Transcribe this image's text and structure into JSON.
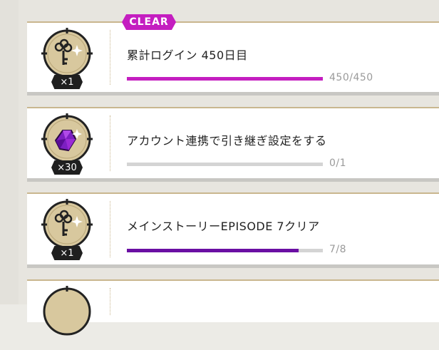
{
  "colors": {
    "clear_badge": "#c41ec0",
    "bar_magenta": "#c41ec0",
    "bar_purple": "#6a0fa3",
    "bar_track": "#d4d4d4",
    "gold_frame": "#c9b68e"
  },
  "missions": [
    {
      "status_badge": "CLEAR",
      "reward_icon": "key-icon",
      "reward_count": "×1",
      "title": "累計ログイン 450日目",
      "progress_text": "450/450",
      "progress_fraction": 1.0,
      "bar_color": "#c41ec0"
    },
    {
      "reward_icon": "gem-icon",
      "reward_count": "×30",
      "title": "アカウント連携で引き継ぎ設定をする",
      "progress_text": "0/1",
      "progress_fraction": 0.0,
      "bar_color": "#c41ec0"
    },
    {
      "reward_icon": "key-icon",
      "reward_count": "×1",
      "title": "メインストーリーEPISODE 7クリア",
      "progress_text": "7/8",
      "progress_fraction": 0.875,
      "bar_color": "#6a0fa3"
    }
  ]
}
